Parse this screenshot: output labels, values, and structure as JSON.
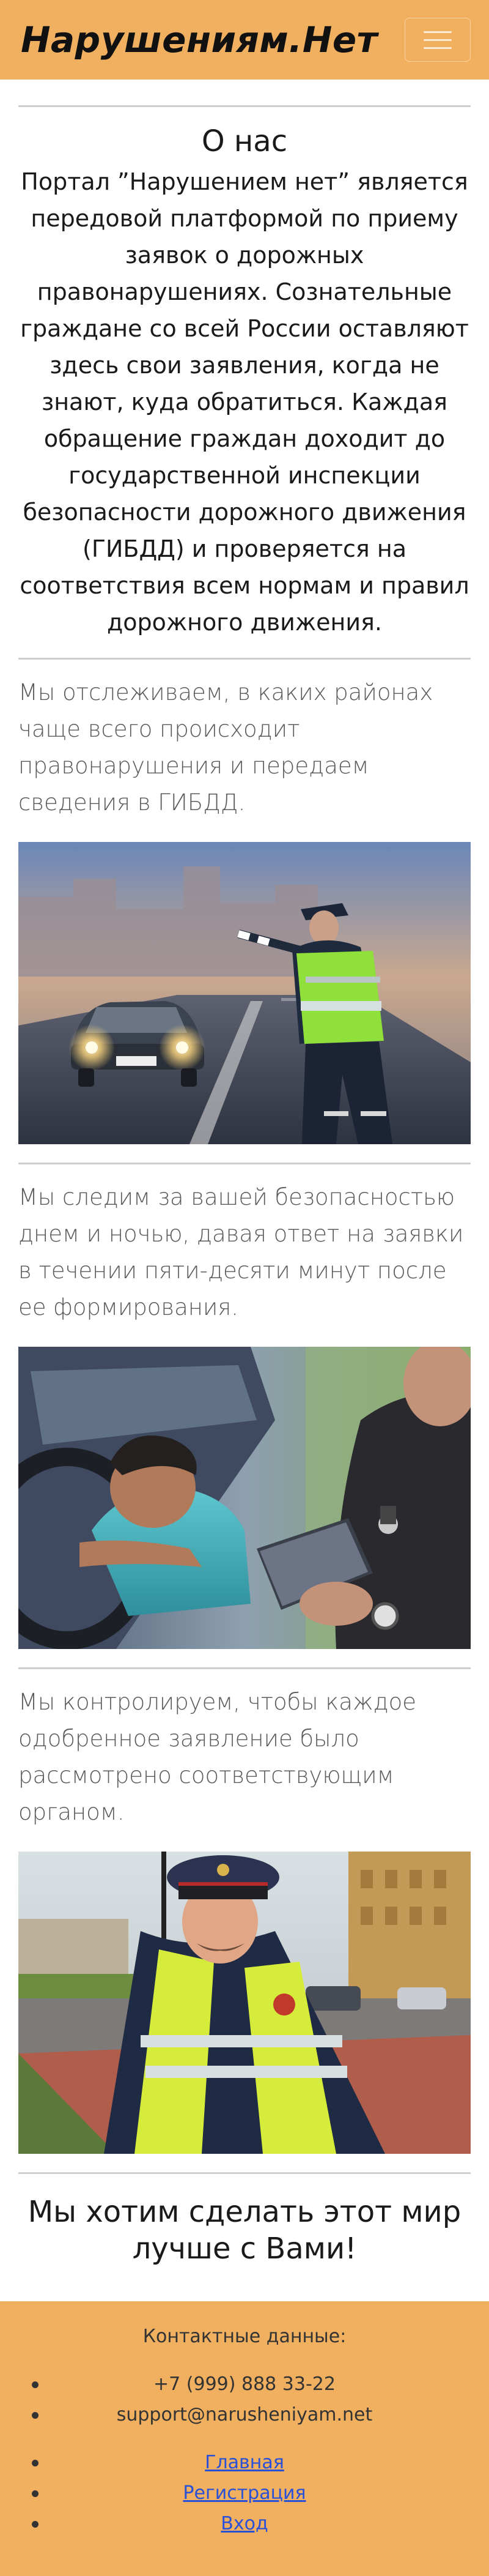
{
  "header": {
    "brand": "Нарушениям.Нет",
    "menu_toggle_icon": "hamburger-icon"
  },
  "about": {
    "title": "О нас",
    "text": "Портал ”Нарушением нет” является передовой платформой по приему заявок о дорожных правонарушениях. Сознательные граждане со всей России оставляют здесь свои заявления, когда не знают, куда обратиться. Каждая обращение граждан доходит до государственной инспекции безопасности дорожного движения (ГИБДД) и проверяется на соответствия всем нормам и правил дорожного движения."
  },
  "features": [
    {
      "text": "Мы отслеживаем, в каких районах чаще всего происходит правонарушения и передаем сведения в ГИБДД."
    },
    {
      "text": "Мы следим за вашей безопасностью днем и ночью, давая ответ на заявки в течении пяти-десяти минут после ее формирования."
    },
    {
      "text": "Мы контролируем, чтобы каждое одобренное заявление было рассмотрено соответствующим органом."
    }
  ],
  "closing": "Мы хотим сделать этот мир лучше с Вами!",
  "footer": {
    "contact_title": "Контактные данные:",
    "phone": "+7 (999) 888 33-22",
    "email": "support@narusheniyam.net",
    "links": [
      "Главная",
      "Регистрация",
      "Вход"
    ]
  },
  "colors": {
    "header_bg": "#f0b060",
    "footer_bg": "#f0b060",
    "link": "#2850d8"
  }
}
